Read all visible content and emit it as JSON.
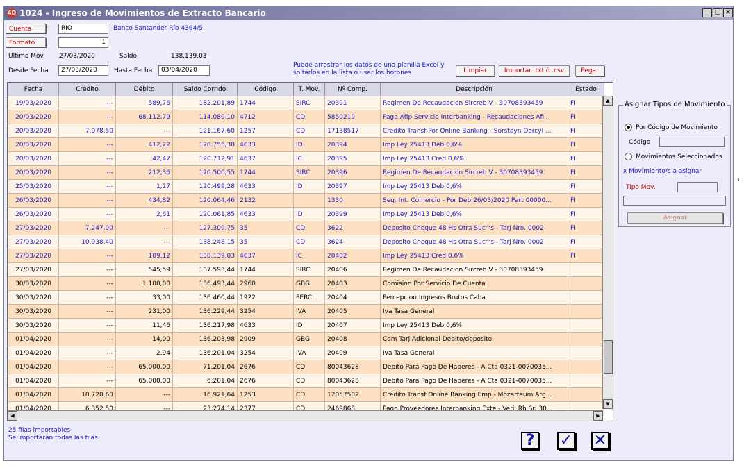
{
  "window": {
    "app_icon": "4D",
    "title": "1024 - Ingreso de Movimientos de Extracto Bancario",
    "controls": [
      "_",
      "□",
      "×"
    ]
  },
  "header": {
    "cuenta_label": "Cuenta",
    "cuenta_value": "RIO",
    "bank_name": "Banco Santander Río 4364/5",
    "formato_label": "Formato",
    "formato_value": "1",
    "ultimo_mov_label": "Ultimo Mov.",
    "ultimo_mov_value": "27/03/2020",
    "saldo_label": "Saldo",
    "saldo_value": "138.139,03",
    "desde_label": "Desde Fecha",
    "desde_value": "27/03/2020",
    "hasta_label": "Hasta Fecha",
    "hasta_value": "03/04/2020",
    "hint_line1": "Puede arrastrar los datos de una planilla Excel y",
    "hint_line2": "soltarlos en la lista ó usar los botones",
    "limpiar": "Limpiar",
    "importar": "Importar .txt ó .csv",
    "pegar": "Pegar"
  },
  "table": {
    "columns": [
      "Fecha",
      "Crédito",
      "Débito",
      "Saldo Corrido",
      "Código",
      "T. Mov.",
      "Nº Comp.",
      "Descripción",
      "Estado"
    ],
    "rows": [
      [
        "19/03/2020",
        "---",
        "589,76",
        "182.201,89",
        "1744",
        "SIRC",
        "20391",
        "Regimen De Recaudacion Sircreb V - 30708393459",
        "FI",
        "blue"
      ],
      [
        "20/03/2020",
        "---",
        "68.112,79",
        "114.089,10",
        "4712",
        "CD",
        "5850219",
        "Pago Afip Servicio Interbanking - Recaudaciones Afi...",
        "FI",
        "blue"
      ],
      [
        "20/03/2020",
        "7.078,50",
        "---",
        "121.167,60",
        "1257",
        "CD",
        "17138517",
        "Credito Transf Por Online Banking - Sorstayn Darcyl ...",
        "FI",
        "blue"
      ],
      [
        "20/03/2020",
        "---",
        "412,22",
        "120.755,38",
        "4633",
        "ID",
        "20394",
        "Imp Ley 25413 Deb 0,6%",
        "FI",
        "blue"
      ],
      [
        "20/03/2020",
        "---",
        "42,47",
        "120.712,91",
        "4637",
        "IC",
        "20395",
        "Imp Ley 25413 Cred 0,6%",
        "FI",
        "blue"
      ],
      [
        "20/03/2020",
        "---",
        "212,36",
        "120.500,55",
        "1744",
        "SIRC",
        "20396",
        "Regimen De Recaudacion Sircreb V - 30708393459",
        "FI",
        "blue"
      ],
      [
        "25/03/2020",
        "---",
        "1,27",
        "120.499,28",
        "4633",
        "ID",
        "20397",
        "Imp Ley 25413 Deb 0,6%",
        "FI",
        "blue"
      ],
      [
        "26/03/2020",
        "---",
        "434,82",
        "120.064,46",
        "2132",
        "",
        "1330",
        "Seg. Int. Comercio - Por Deb:26/03/2020 Part 00000...",
        "FI",
        "blue"
      ],
      [
        "26/03/2020",
        "---",
        "2,61",
        "120.061,85",
        "4633",
        "ID",
        "20399",
        "Imp Ley 25413 Deb 0,6%",
        "FI",
        "blue"
      ],
      [
        "27/03/2020",
        "7.247,90",
        "---",
        "127.309,75",
        "35",
        "CD",
        "3622",
        "Deposito Cheque 48 Hs Otra Suc^s - Tarj Nro. 0002",
        "FI",
        "blue"
      ],
      [
        "27/03/2020",
        "10.938,40",
        "---",
        "138.248,15",
        "35",
        "CD",
        "3624",
        "Deposito Cheque 48 Hs Otra Suc^s - Tarj Nro. 0002",
        "FI",
        "blue"
      ],
      [
        "27/03/2020",
        "---",
        "109,12",
        "138.139,03",
        "4637",
        "IC",
        "20402",
        "Imp Ley 25413 Cred 0,6%",
        "FI",
        "blue"
      ],
      [
        "27/03/2020",
        "---",
        "545,59",
        "137.593,44",
        "1744",
        "SIRC",
        "20406",
        "Regimen De Recaudacion Sircreb V - 30708393459",
        "",
        "black"
      ],
      [
        "30/03/2020",
        "---",
        "1.100,00",
        "136.493,44",
        "2960",
        "GBG",
        "20403",
        "Comision Por Servicio De Cuenta",
        "",
        "black"
      ],
      [
        "30/03/2020",
        "---",
        "33,00",
        "136.460,44",
        "1922",
        "PERC",
        "20404",
        "Percepcion Ingresos Brutos Caba",
        "",
        "black"
      ],
      [
        "30/03/2020",
        "---",
        "231,00",
        "136.229,44",
        "3254",
        "IVA",
        "20405",
        "Iva Tasa General",
        "",
        "black"
      ],
      [
        "30/03/2020",
        "---",
        "11,46",
        "136.217,98",
        "4633",
        "ID",
        "20407",
        "Imp Ley 25413 Deb 0,6%",
        "",
        "black"
      ],
      [
        "01/04/2020",
        "---",
        "14,00",
        "136.203,98",
        "2909",
        "GBG",
        "20408",
        "Com Tarj Adicional Debito/deposito",
        "",
        "black"
      ],
      [
        "01/04/2020",
        "---",
        "2,94",
        "136.201,04",
        "3254",
        "IVA",
        "20409",
        "Iva Tasa General",
        "",
        "black"
      ],
      [
        "01/04/2020",
        "---",
        "65.000,00",
        "71.201,04",
        "2676",
        "CD",
        "80043628",
        "Debito Para Pago De Haberes - A Cta 0321-0070035...",
        "",
        "black"
      ],
      [
        "01/04/2020",
        "---",
        "65.000,00",
        "6.201,04",
        "2676",
        "CD",
        "80043628",
        "Debito Para Pago De Haberes - A Cta 0321-0070035...",
        "",
        "black"
      ],
      [
        "01/04/2020",
        "10.720,60",
        "---",
        "16.921,64",
        "1253",
        "CD",
        "12057502",
        "Credito Transf Online Banking Emp - Mozarteum Arg...",
        "",
        "black"
      ],
      [
        "01/04/2020",
        "6.352,50",
        "---",
        "23.274,14",
        "2377",
        "CD",
        "2469868",
        "Pago Proveedores Interbanking Exte - Veril Rh Srl 30...",
        "",
        "black"
      ]
    ]
  },
  "assign": {
    "group_title": "Asignar Tipos de Movimiento",
    "opt_codigo": "Por Código de Movimiento",
    "codigo_label": "Código",
    "opt_seleccionados": "Movimientos Seleccionados",
    "x_mov": "x Movimiento/s a asignar",
    "tipo_mov_label": "Tipo Mov.",
    "asignar": "Asignar"
  },
  "footer": {
    "status1": "25 filas importables",
    "status2": "Se importarán todas las filas",
    "help": "?",
    "ok": "✓",
    "cancel": "✕"
  }
}
